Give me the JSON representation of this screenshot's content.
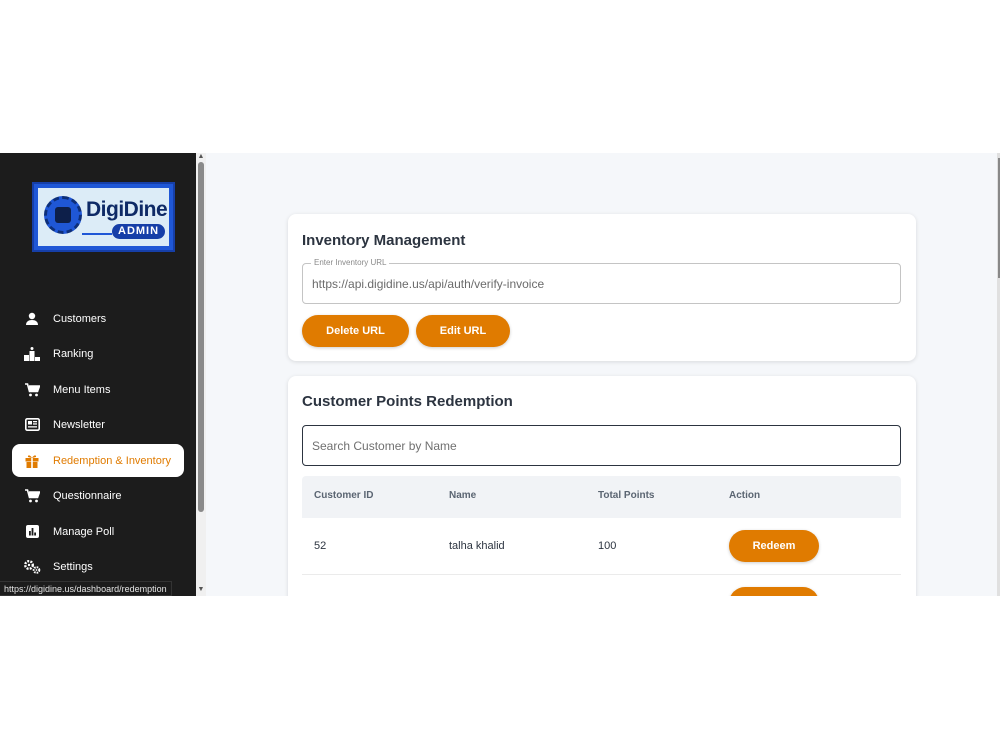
{
  "sidebar": {
    "logo": {
      "brand": "DigiDine",
      "sub": "ADMIN"
    },
    "items": [
      {
        "label": "Customers",
        "icon": "person-icon"
      },
      {
        "label": "Ranking",
        "icon": "podium-icon"
      },
      {
        "label": "Menu Items",
        "icon": "cart-icon"
      },
      {
        "label": "Newsletter",
        "icon": "newspaper-icon"
      },
      {
        "label": "Redemption & Inventory",
        "icon": "gift-icon",
        "active": true
      },
      {
        "label": "Questionnaire",
        "icon": "cart-icon"
      },
      {
        "label": "Manage Poll",
        "icon": "poll-icon"
      },
      {
        "label": "Settings",
        "icon": "gears-icon"
      }
    ]
  },
  "status_url": "https://digidine.us/dashboard/redemption",
  "inventory": {
    "title": "Inventory Management",
    "field_label": "Enter Inventory URL",
    "field_value": "https://api.digidine.us/api/auth/verify-invoice",
    "delete_label": "Delete URL",
    "edit_label": "Edit URL"
  },
  "redemption": {
    "title": "Customer Points Redemption",
    "search_placeholder": "Search Customer by Name",
    "columns": [
      "Customer ID",
      "Name",
      "Total Points",
      "Action"
    ],
    "rows": [
      {
        "id": "52",
        "name": "talha khalid",
        "points": "100",
        "action": "Redeem"
      },
      {
        "id": "",
        "name": "",
        "points": "",
        "action": ""
      }
    ]
  },
  "colors": {
    "accent": "#e07b00",
    "sidebar": "#1c1c1c",
    "background": "#f5f7fa"
  }
}
